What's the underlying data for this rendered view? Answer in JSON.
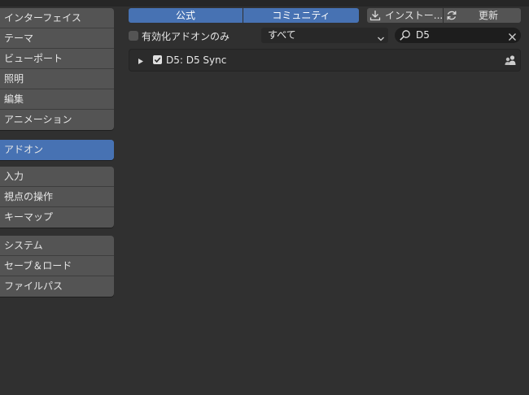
{
  "sidebar": {
    "group1": [
      "インターフェイス",
      "テーマ",
      "ビューポート",
      "照明",
      "編集",
      "アニメーション"
    ],
    "active": "アドオン",
    "group2": [
      "入力",
      "視点の操作",
      "キーマップ"
    ],
    "group3": [
      "システム",
      "セーブ＆ロード",
      "ファイルパス"
    ]
  },
  "header": {
    "tab_official": "公式",
    "tab_community": "コミュニティ",
    "install_label": "インストー...",
    "refresh_label": "更新"
  },
  "filters": {
    "enabled_only_label": "有効化アドオンのみ",
    "category_value": "すべて",
    "search_value": "D5"
  },
  "addons": [
    {
      "name": "D5: D5 Sync",
      "enabled": true
    }
  ]
}
